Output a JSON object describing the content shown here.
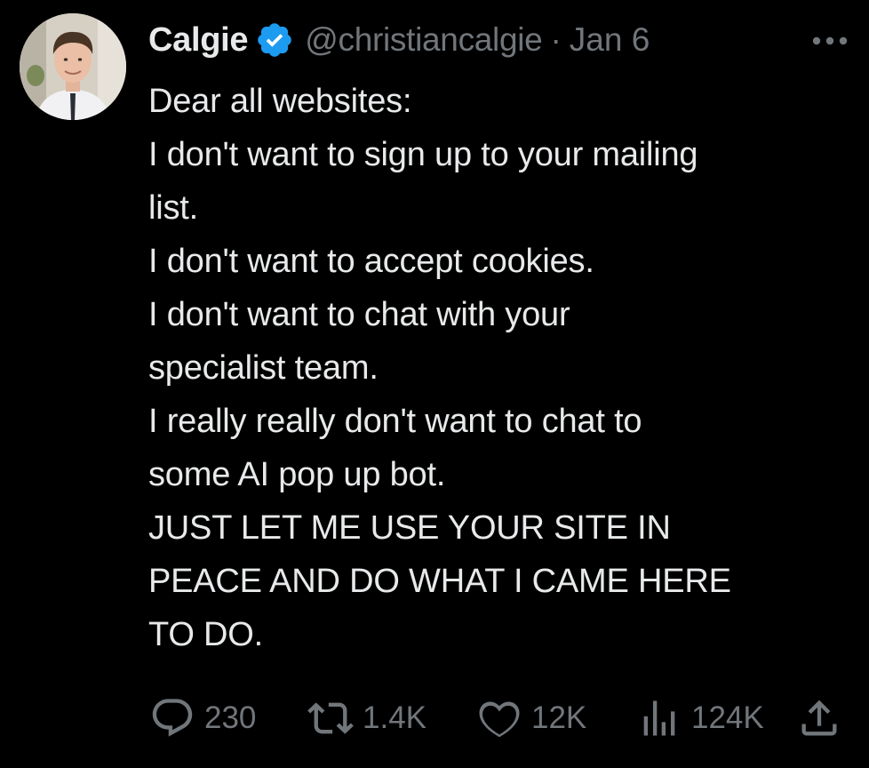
{
  "author": {
    "display_name": "Calgie",
    "handle": "@christiancalgie",
    "separator": "·",
    "date": "Jan 6"
  },
  "tweet": {
    "lines": [
      "Dear all websites:",
      "I don't want to sign up to your mailing",
      "list.",
      "I don't want to accept cookies.",
      "I don't want to chat with your",
      "specialist team.",
      "I really really don't want to chat to",
      "some AI pop up bot.",
      "JUST LET ME USE YOUR SITE IN",
      "PEACE AND DO WHAT I CAME HERE",
      "TO DO."
    ]
  },
  "metrics": {
    "replies": "230",
    "reposts": "1.4K",
    "likes": "12K",
    "views": "124K"
  },
  "icons": {
    "verified": "verified-badge-icon",
    "more": "more-horizontal-icon",
    "reply": "reply-icon",
    "repost": "repost-icon",
    "like": "heart-icon",
    "views": "views-chart-icon",
    "share": "share-icon"
  },
  "colors": {
    "background": "#000000",
    "text_primary": "#e7e9ea",
    "text_secondary": "#71767b",
    "verified_blue": "#1d9bf0"
  }
}
